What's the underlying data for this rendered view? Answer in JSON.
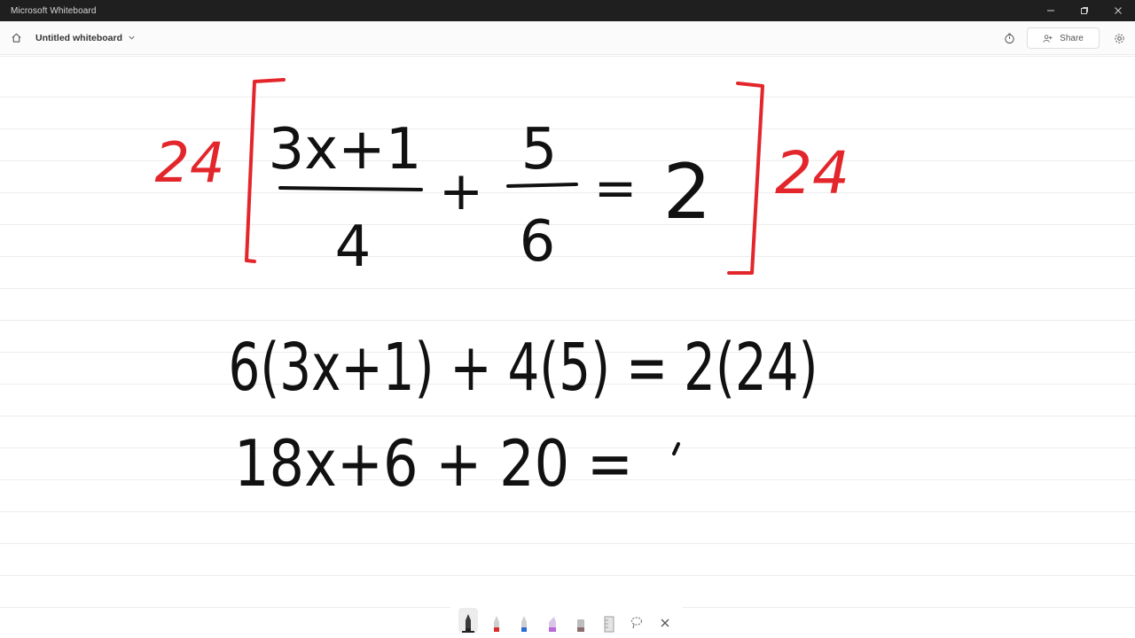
{
  "window": {
    "title": "Microsoft Whiteboard"
  },
  "appbar": {
    "board_name": "Untitled whiteboard",
    "share_label": "Share"
  },
  "canvas": {
    "ink": {
      "line1": {
        "left_multiplier": "24",
        "fraction1_numerator": "3x+1",
        "fraction1_denominator": "4",
        "plus": "+",
        "fraction2_numerator": "5",
        "fraction2_denominator": "6",
        "equals": "=",
        "rhs": "2",
        "right_multiplier": "24"
      },
      "line2": {
        "text": "6(3x+1) + 4(5) = 2(24)"
      },
      "line3": {
        "text": "18x+6 + 20 = "
      }
    },
    "colors": {
      "black_ink": "#111111",
      "red_ink": "#e3262b"
    }
  },
  "toolbar": {
    "tools": [
      {
        "name": "black-pen",
        "color": "#222222",
        "selected": true
      },
      {
        "name": "red-pen",
        "color": "#d92b2b"
      },
      {
        "name": "blue-pen",
        "color": "#2c6bd6"
      },
      {
        "name": "highlighter",
        "color": "#b86bd8"
      },
      {
        "name": "eraser",
        "color": "#9e9e9e"
      },
      {
        "name": "ruler",
        "color": "#9e9e9e"
      },
      {
        "name": "lasso",
        "color": "#9e9e9e"
      },
      {
        "name": "close",
        "color": "#555555"
      }
    ]
  }
}
